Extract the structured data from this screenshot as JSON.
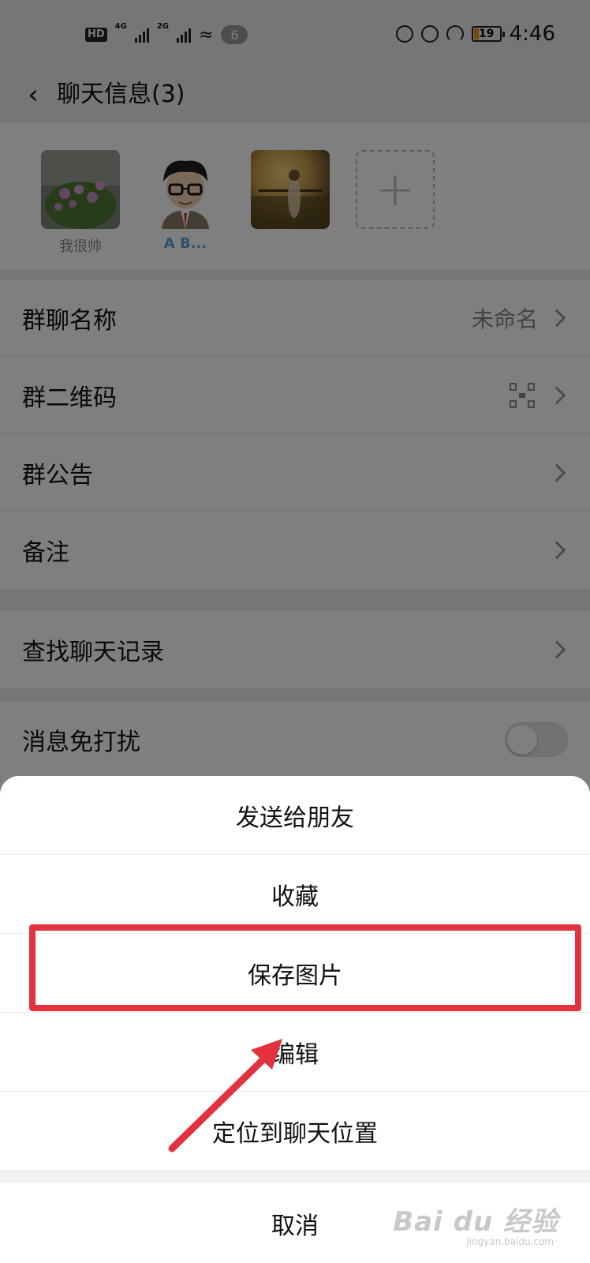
{
  "status_bar": {
    "hd": "HD",
    "net1": "4G",
    "net2": "2G",
    "notification_count": "6",
    "battery": "19",
    "time": "4:46"
  },
  "header": {
    "title": "聊天信息(3)"
  },
  "members": [
    {
      "name": "我很帅"
    },
    {
      "name": "A B..."
    },
    {
      "name": ""
    }
  ],
  "settings": {
    "group1": [
      {
        "label": "群聊名称",
        "value": "未命名"
      },
      {
        "label": "群二维码",
        "value": ""
      },
      {
        "label": "群公告",
        "value": ""
      },
      {
        "label": "备注",
        "value": ""
      }
    ],
    "group2": [
      {
        "label": "查找聊天记录"
      }
    ],
    "group3": [
      {
        "label": "消息免打扰",
        "toggle": false
      }
    ]
  },
  "sheet": {
    "items": [
      "发送给朋友",
      "收藏",
      "保存图片",
      "编辑",
      "定位到聊天位置"
    ],
    "cancel": "取消"
  },
  "annotation": {
    "highlight_color": "#e2323f"
  },
  "watermark": {
    "brand": "Bai du 经验",
    "url": "jingyan.baidu.com"
  }
}
